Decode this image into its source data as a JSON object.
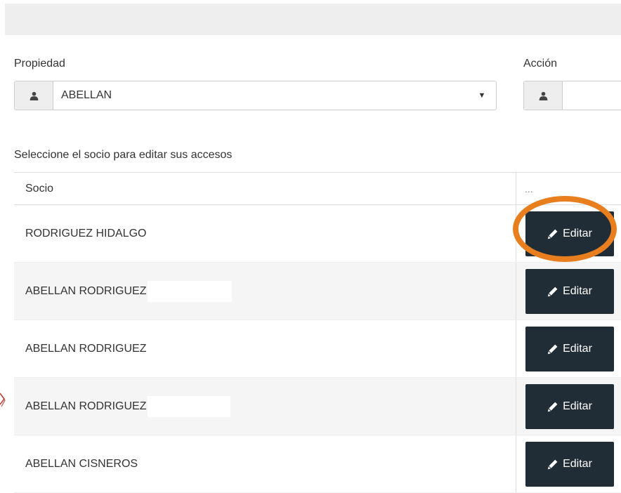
{
  "form": {
    "propiedad_label": "Propiedad",
    "propiedad_value": "ABELLAN",
    "accion_label": "Acción",
    "accion_value": "",
    "addon_icon": "user-icon",
    "dropdown_icon": "caret-down-icon"
  },
  "instructions": "Seleccione el socio para editar sus accesos",
  "table": {
    "columns": [
      "Socio",
      "..."
    ],
    "rows": [
      {
        "name": "RODRIGUEZ HIDALGO",
        "button": "Editar",
        "highlighted": true
      },
      {
        "name": "ABELLAN RODRIGUEZ",
        "button": "Editar"
      },
      {
        "name": "ABELLAN RODRIGUEZ",
        "button": "Editar"
      },
      {
        "name": "ABELLAN RODRIGUEZ",
        "button": "Editar"
      },
      {
        "name": "ABELLAN CISNEROS",
        "button": "Editar"
      }
    ]
  },
  "colors": {
    "button_bg": "#212d36",
    "highlight": "#e87e1e",
    "stripe": "#f5f5f5"
  }
}
